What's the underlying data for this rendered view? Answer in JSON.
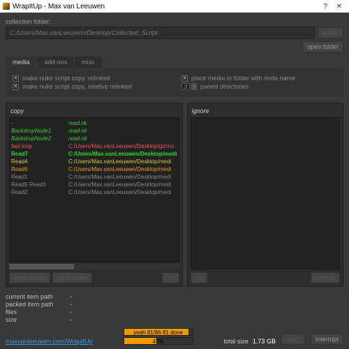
{
  "window": {
    "title": "WrapItUp - Max van Leeuwen",
    "help": "?",
    "close": "✕"
  },
  "collection": {
    "label": "collection folder:",
    "path": "C:/Users/Max.vanLeeuwen/Desktop/Collected_Script",
    "folder_btn": "folder",
    "open_btn": "open folder"
  },
  "tabs": {
    "media": "media",
    "addons": "add-ons",
    "misc": "misc"
  },
  "options": {
    "copy_relinked": "make nuke script copy, relinked",
    "copy_relative": "make nuke script copy, relative relinked",
    "place_media": "place media in folder with node name",
    "parent_dirs": "parent directories",
    "parent_val": "3"
  },
  "panels": {
    "copy": "copy",
    "ignore": "ignore"
  },
  "copy_rows": [
    {
      "c1": "-",
      "c2": "read.nk",
      "cls": "g"
    },
    {
      "c1": "BackdropNode1",
      "c2": "read.nk",
      "cls": "gi"
    },
    {
      "c1": "BackdropNode2",
      "c2": "read.nk",
      "cls": "gi"
    },
    {
      "c1": "fast loop",
      "c2": "C:/Users/Max.vanLeeuwen/Desktop/gizmo",
      "cls": "r"
    },
    {
      "c1": "",
      "c2": "",
      "cls": "gr"
    },
    {
      "c1": "Read7",
      "c2": "C:/Users/Max.vanLeeuwen/Desktop/medi",
      "cls": "gb"
    },
    {
      "c1": "Read4",
      "c2": "C:/Users/Max.vanLeeuwen/Desktop/medi",
      "cls": "y"
    },
    {
      "c1": "Read6",
      "c2": "C:/Users/Max.vanLeeuwen/Desktop/medi",
      "cls": "o"
    },
    {
      "c1": "Read1",
      "c2": "C:/Users/Max.vanLeeuwen/Desktop/medi",
      "cls": "gr"
    },
    {
      "c1": "Read5 Read3",
      "c2": "C:/Users/Max.vanLeeuwen/Desktop/medi",
      "cls": "gr"
    },
    {
      "c1": "Read2",
      "c2": "C:/Users/Max.vanLeeuwen/Desktop/medi",
      "cls": "gr"
    }
  ],
  "panel_btns": {
    "open_folder": "open folder",
    "go_node": "go to node",
    "arrow_r": ">>",
    "arrow_l": "<<",
    "refresh": "refresh"
  },
  "info": {
    "cur": "current item path",
    "pack": "packed item path",
    "files": "files",
    "size": "size",
    "dash": "-"
  },
  "progress": {
    "label1": "yeah 81/86 81 done",
    "pct": "47%",
    "fill1": 94,
    "fill2": 47
  },
  "totals": {
    "label": "total size",
    "value": "1.73 GB"
  },
  "actions": {
    "start": "start!",
    "interrupt": "interrupt"
  },
  "link": "maxvanleeuwen.com/WrapItUp"
}
